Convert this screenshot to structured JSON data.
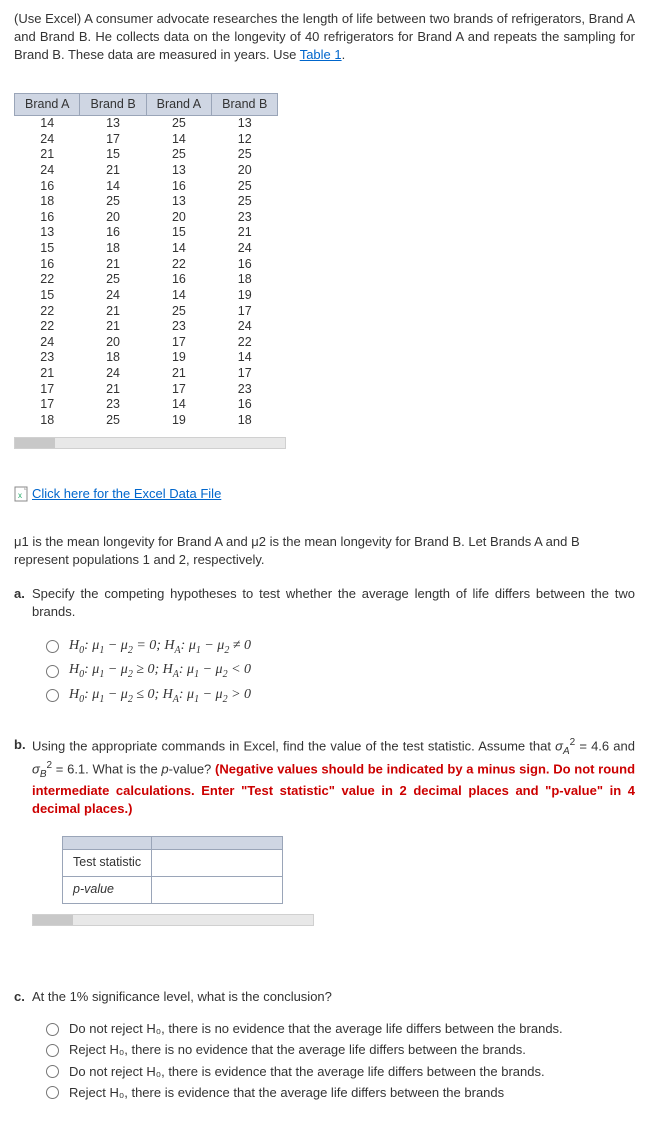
{
  "intro_prefix": "(Use Excel) A consumer advocate researches the length of life between two brands of refrigerators, Brand A and Brand B. He collects data on the longevity of 40 refrigerators for Brand A and repeats the sampling for Brand B. These data are measured in years. Use ",
  "intro_link": "Table 1",
  "intro_suffix": ".",
  "headers": [
    "Brand A",
    "Brand B",
    "Brand A",
    "Brand B"
  ],
  "rows": [
    [
      14,
      13,
      25,
      13
    ],
    [
      24,
      17,
      14,
      12
    ],
    [
      21,
      15,
      25,
      25
    ],
    [
      24,
      21,
      13,
      20
    ],
    [
      16,
      14,
      16,
      25
    ],
    [
      18,
      25,
      13,
      25
    ],
    [
      16,
      20,
      20,
      23
    ],
    [
      13,
      16,
      15,
      21
    ],
    [
      15,
      18,
      14,
      24
    ],
    [
      16,
      21,
      22,
      16
    ],
    [
      22,
      25,
      16,
      18
    ],
    [
      15,
      24,
      14,
      19
    ],
    [
      22,
      21,
      25,
      17
    ],
    [
      22,
      21,
      23,
      24
    ],
    [
      24,
      20,
      17,
      22
    ],
    [
      23,
      18,
      19,
      14
    ],
    [
      21,
      24,
      21,
      17
    ],
    [
      17,
      21,
      17,
      23
    ],
    [
      17,
      23,
      14,
      16
    ],
    [
      18,
      25,
      19,
      18
    ]
  ],
  "excel_link": "Click here for the Excel Data File",
  "mu_desc": "μ1 is the mean longevity for Brand A and μ2 is the mean longevity for Brand B. Let Brands A and B represent populations 1 and 2, respectively.",
  "qa": {
    "label": "a.",
    "text": "Specify the competing hypotheses to test whether the average length of life differs between the two brands."
  },
  "qb": {
    "label": "b.",
    "part1": "Using the appropriate commands in Excel, find the value of the test statistic. Assume that ",
    "sigmaA": "σ",
    "subA": "A",
    "eqA": " = 4.6 and ",
    "sigmaB": "σ",
    "subB": "B",
    "eqB": " = 6.1. What is the ",
    "pval": "p",
    "part2": "-value? ",
    "note": "(Negative values should be indicated by a minus sign. Do not round intermediate calculations. Enter \"Test statistic\" value in 2 decimal places and \"p-value\" in 4 decimal places.)"
  },
  "answer_labels": {
    "test_stat": "Test statistic",
    "pval": "p-value"
  },
  "qc": {
    "label": "c.",
    "text": "At the 1% significance level, what is the conclusion?"
  },
  "c_opts": [
    "Do not reject H₀, there is no evidence that the average life differs between the brands.",
    "Reject H₀, there is no evidence that the average life differs between the brands.",
    "Do not reject H₀, there is evidence that the average life differs between the brands.",
    "Reject H₀, there is evidence that the average life differs between the brands"
  ],
  "chart_data": {
    "type": "table",
    "title": "Refrigerator longevity (years) — Brand A vs Brand B, 40 observations each",
    "columns": [
      "Brand A",
      "Brand B",
      "Brand A",
      "Brand B"
    ],
    "data": [
      [
        14,
        13,
        25,
        13
      ],
      [
        24,
        17,
        14,
        12
      ],
      [
        21,
        15,
        25,
        25
      ],
      [
        24,
        21,
        13,
        20
      ],
      [
        16,
        14,
        16,
        25
      ],
      [
        18,
        25,
        13,
        25
      ],
      [
        16,
        20,
        20,
        23
      ],
      [
        13,
        16,
        15,
        21
      ],
      [
        15,
        18,
        14,
        24
      ],
      [
        16,
        21,
        22,
        16
      ],
      [
        22,
        25,
        16,
        18
      ],
      [
        15,
        24,
        14,
        19
      ],
      [
        22,
        21,
        25,
        17
      ],
      [
        22,
        21,
        23,
        24
      ],
      [
        24,
        20,
        17,
        22
      ],
      [
        23,
        18,
        19,
        14
      ],
      [
        21,
        24,
        21,
        17
      ],
      [
        17,
        21,
        17,
        23
      ],
      [
        17,
        23,
        14,
        16
      ],
      [
        18,
        25,
        19,
        18
      ]
    ]
  }
}
